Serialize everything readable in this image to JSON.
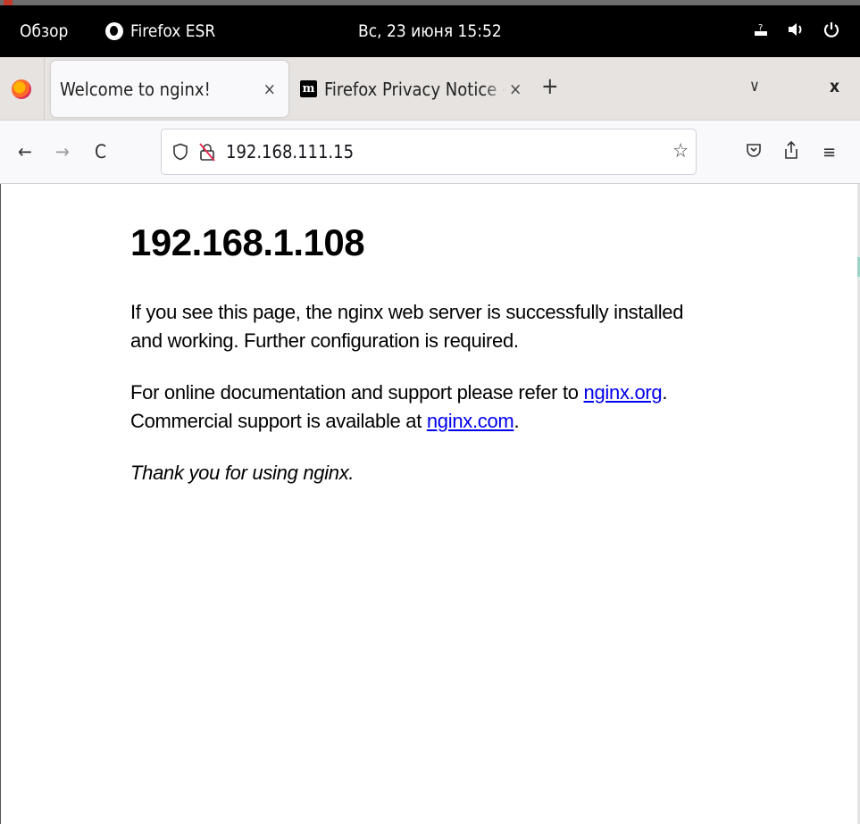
{
  "system_bar": {
    "overview": "Обзор",
    "app_name": "Firefox ESR",
    "clock": "Вс, 23 июня  15:52"
  },
  "tabs": [
    {
      "title": "Welcome to nginx!",
      "close": "×",
      "active": true
    },
    {
      "favicon": "m",
      "title": "Firefox Privacy Notice — Mozilla",
      "close": "×",
      "active": false
    }
  ],
  "tabstrip": {
    "new_tab": "+",
    "list_all": "∨",
    "close_window": "x"
  },
  "navigation": {
    "back": "←",
    "forward": "→",
    "reload": "C",
    "url": "192.168.111.15",
    "bookmark": "☆",
    "pocket": "⊡",
    "share": "⇪",
    "menu": "≡"
  },
  "page": {
    "heading": "192.168.1.108",
    "para1": "If you see this page, the nginx web server is successfully installed and working. Further configuration is required.",
    "para2_prefix": "For online documentation and support please refer to ",
    "link1": "nginx.org",
    "para2_mid": ".",
    "para2_line2": "Commercial support is available at ",
    "link2": "nginx.com",
    "para2_suffix": ".",
    "thanks": "Thank you for using nginx."
  },
  "colors": {
    "link": "#0000ee",
    "system_bar": "#000000",
    "tabstrip": "#e6e3e0"
  }
}
